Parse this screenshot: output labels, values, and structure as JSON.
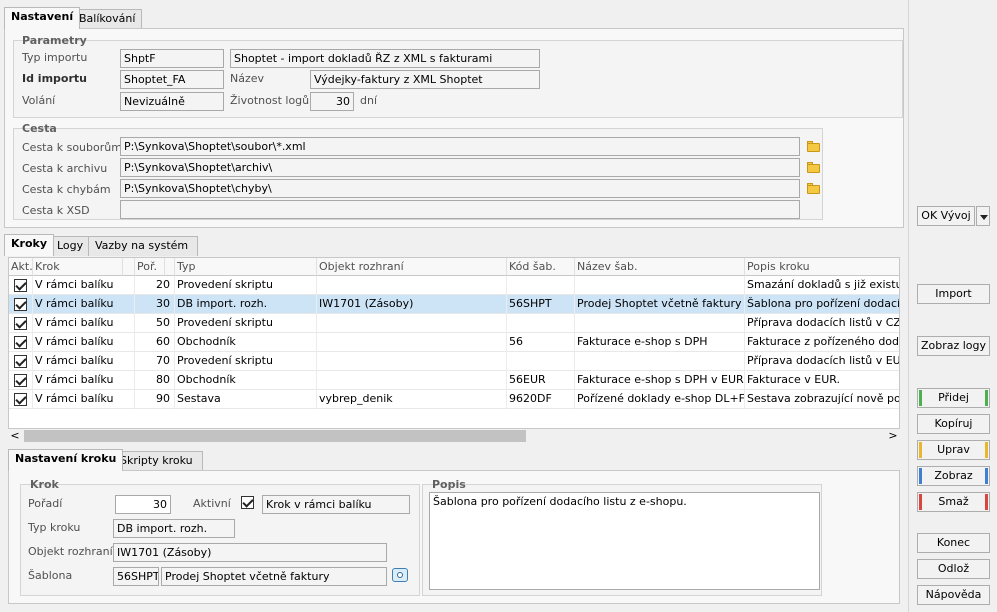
{
  "top_tabs": [
    "Nastavení",
    "Balíkování"
  ],
  "parametry": {
    "title": "Parametry",
    "typ_importu_label": "Typ importu",
    "typ_importu_code": "ShptF",
    "typ_importu_name": "Shoptet - import dokladů ŘZ z XML s fakturami",
    "id_importu_label": "Id importu",
    "id_importu_value": "Shoptet_FA",
    "nazev_label": "Název",
    "nazev_value": "Výdejky-faktury z XML Shoptet",
    "volani_label": "Volání",
    "volani_value": "Nevizuálně",
    "zivotnost_label": "Životnost logů",
    "zivotnost_value": "30",
    "zivotnost_unit": "dní"
  },
  "cesta": {
    "title": "Cesta",
    "soubory_label": "Cesta k souborům",
    "soubory_value": "P:\\Synkova\\Shoptet\\soubor\\*.xml",
    "archiv_label": "Cesta k archivu",
    "archiv_value": "P:\\Synkova\\Shoptet\\archiv\\",
    "chyby_label": "Cesta k chybám",
    "chyby_value": "P:\\Synkova\\Shoptet\\chyby\\",
    "xsd_label": "Cesta k XSD",
    "xsd_value": ""
  },
  "mid_tabs": [
    "Kroky",
    "Logy",
    "Vazby na systém"
  ],
  "grid": {
    "headers": [
      "Akt.",
      "Krok",
      "",
      "Poř.",
      "",
      "Typ",
      "Objekt rozhraní",
      "Kód šab.",
      "Název šab.",
      "Popis kroku"
    ],
    "rows": [
      {
        "krok": "V rámci balíku",
        "por": "20",
        "typ": "Provedení skriptu",
        "objekt": "",
        "kod": "",
        "nazev": "",
        "popis": "Smazání dokladů s již existu"
      },
      {
        "krok": "V rámci balíku",
        "por": "30",
        "typ": "DB import. rozh.",
        "objekt": "IW1701 (Zásoby)",
        "kod": "56SHPT",
        "nazev": "Prodej Shoptet včetně faktury",
        "popis": "Šablona pro pořízení dodací"
      },
      {
        "krok": "V rámci balíku",
        "por": "50",
        "typ": "Provedení skriptu",
        "objekt": "",
        "kod": "",
        "nazev": "",
        "popis": "Příprava dodacích listů v CZ"
      },
      {
        "krok": "V rámci balíku",
        "por": "60",
        "typ": "Obchodník",
        "objekt": "",
        "kod": "56",
        "nazev": "Fakturace e-shop s DPH",
        "popis": "Fakturace z pořízeného doda"
      },
      {
        "krok": "V rámci balíku",
        "por": "70",
        "typ": "Provedení skriptu",
        "objekt": "",
        "kod": "",
        "nazev": "",
        "popis": "Příprava dodacích listů v EU"
      },
      {
        "krok": "V rámci balíku",
        "por": "80",
        "typ": "Obchodník",
        "objekt": "",
        "kod": "56EUR",
        "nazev": "Fakturace e-shop s DPH v EUR",
        "popis": "Fakturace v EUR."
      },
      {
        "krok": "V rámci balíku",
        "por": "90",
        "typ": "Sestava",
        "objekt": "vybrep_denik",
        "kod": "9620DF",
        "nazev": "Pořízené doklady e-shop DL+FA",
        "popis": "Sestava zobrazující nově poř"
      }
    ],
    "scroll_left": "<",
    "scroll_right": ">"
  },
  "bottom_tabs": [
    "Nastavení kroku",
    "Skripty kroku"
  ],
  "krok": {
    "title": "Krok",
    "poradi_label": "Pořadí",
    "poradi_value": "30",
    "aktivni_label": "Aktivní",
    "aktivni_value": "Krok v rámci balíku",
    "typ_label": "Typ kroku",
    "typ_value": "DB import. rozh.",
    "objekt_label": "Objekt rozhraní",
    "objekt_value": "IW1701 (Zásoby)",
    "sablona_label": "Šablona",
    "sablona_code": "56SHPT",
    "sablona_name": "Prodej Shoptet včetně faktury"
  },
  "popis": {
    "title": "Popis",
    "value": "Šablona pro pořízení dodacího listu z e-shopu."
  },
  "buttons": {
    "ok_vyvoj": "OK Vývoj",
    "import": "Import",
    "zobraz_logy": "Zobraz logy",
    "pridej": "Přidej",
    "kopiruj": "Kopíruj",
    "uprav": "Uprav",
    "zobraz": "Zobraz",
    "smaz": "Smaž",
    "konec": "Konec",
    "odloz": "Odlož",
    "napoveda": "Nápověda"
  },
  "colors": {
    "selected_row": "#cde4f7",
    "green": "#4caf50",
    "yellow": "#e8b72c",
    "blue": "#3f7fd1",
    "red": "#d9463d"
  }
}
